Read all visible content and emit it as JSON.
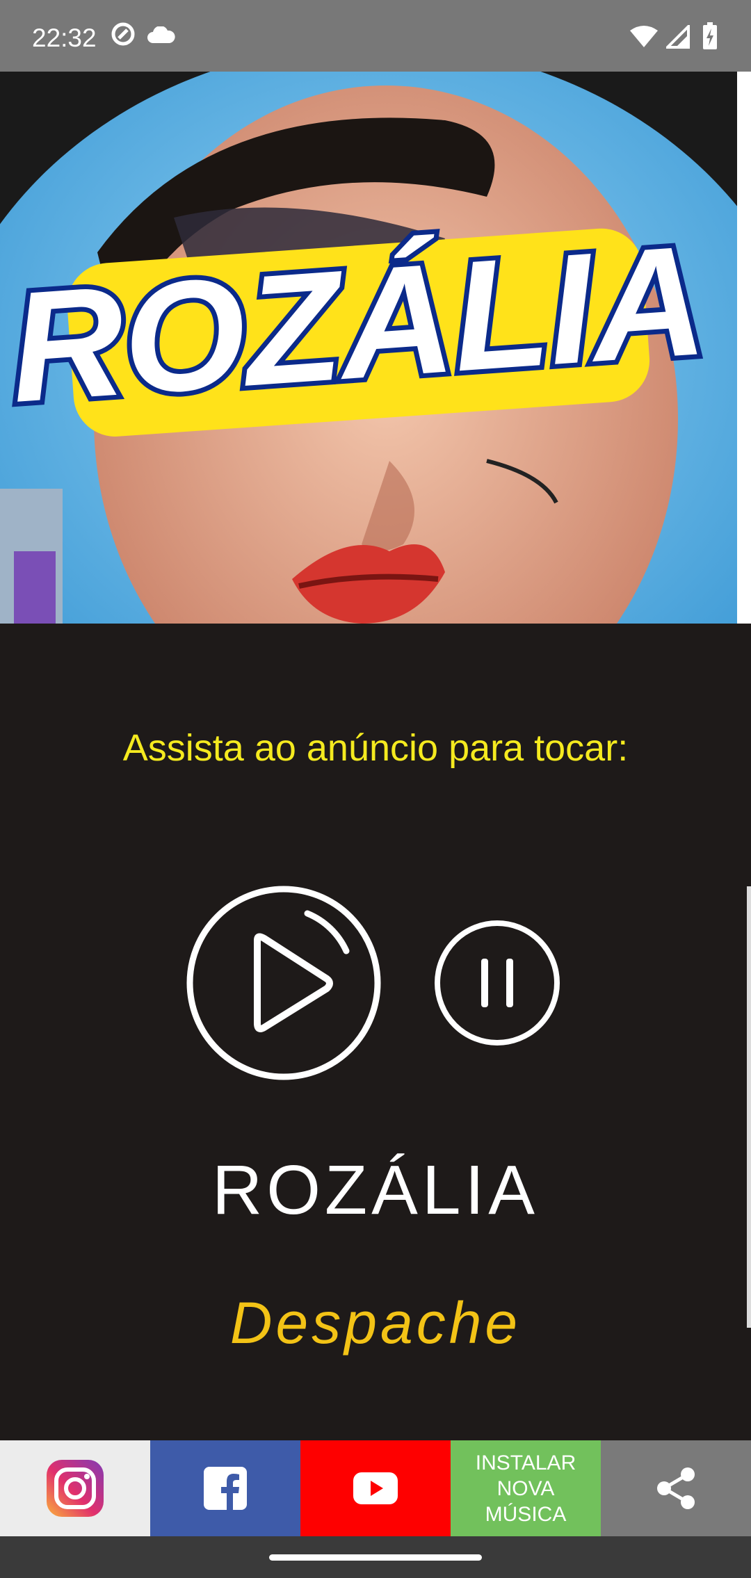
{
  "status_bar": {
    "time": "22:32",
    "icons": [
      "sync-icon",
      "cloud-icon",
      "wifi-icon",
      "signal-icon",
      "battery-charging-icon"
    ]
  },
  "cover": {
    "logo_text": "ROZÁLIA",
    "colors": {
      "sky": "#3fa6e0",
      "logo_fill": "#ffffff",
      "logo_outline": "#0b2a8a",
      "logo_glow": "#ffe21a"
    }
  },
  "player": {
    "prompt": "Assista ao anúncio para tocar:",
    "artist": "ROZÁLIA",
    "song": "Despache",
    "play_icon": "play-icon",
    "pause_icon": "pause-icon"
  },
  "bottom_bar": {
    "instagram_icon": "instagram-icon",
    "facebook_icon": "facebook-icon",
    "youtube_icon": "youtube-icon",
    "install_lines": [
      "INSTALAR",
      "NOVA",
      "MÚSICA"
    ],
    "share_icon": "share-icon",
    "colors": {
      "instagram_bg": "#ececec",
      "facebook_bg": "#3e5ba9",
      "youtube_bg": "#fe0000",
      "install_bg": "#72c15c",
      "share_bg": "#7a7a7a"
    }
  },
  "theme": {
    "background": "#1e1a19",
    "prompt_color": "#f5ea1f",
    "song_color": "#f3c316"
  }
}
